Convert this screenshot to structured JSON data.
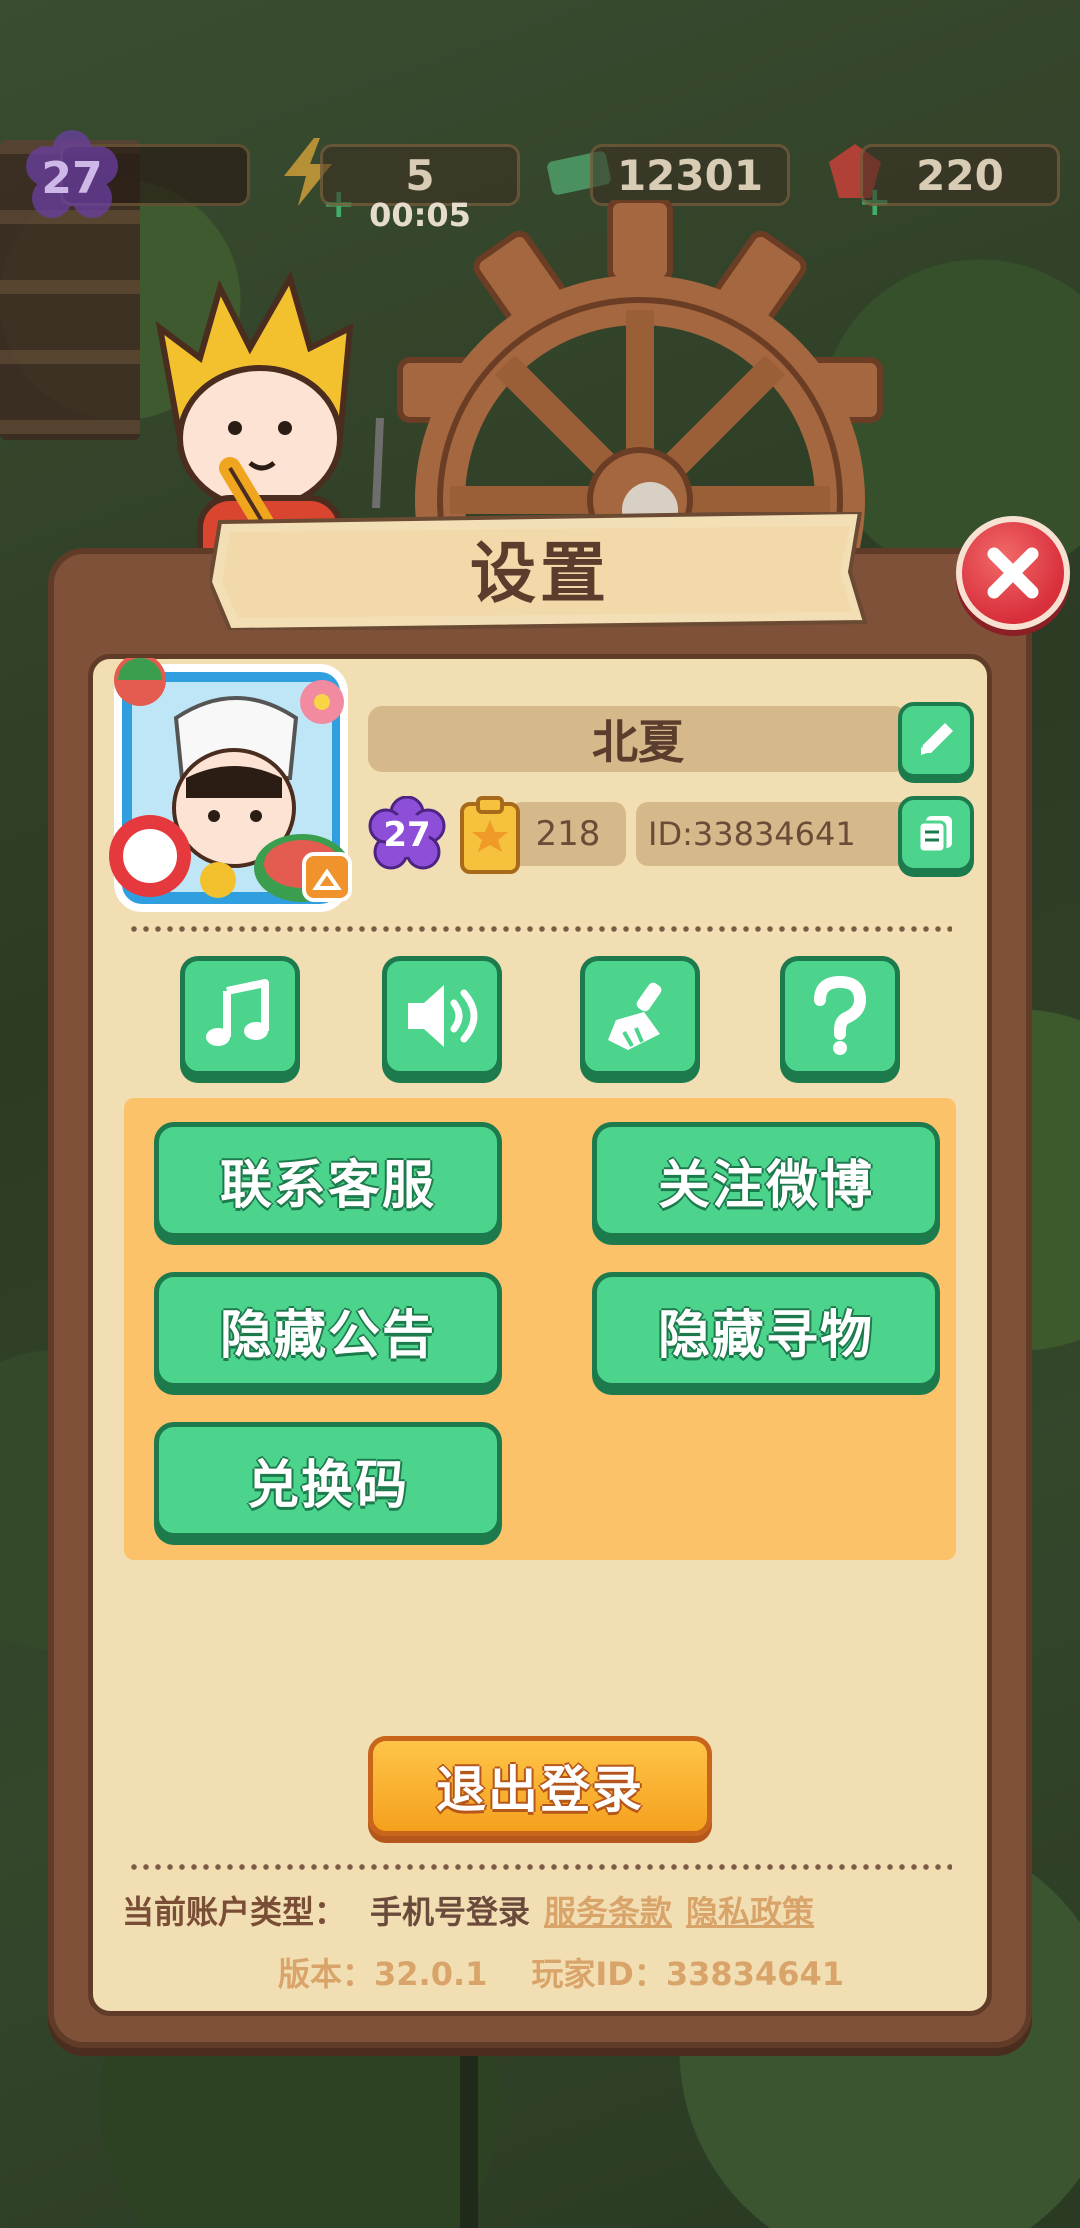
{
  "topbar": {
    "level": "27",
    "energy": "5",
    "energy_timer": "00:05",
    "cash": "12301",
    "gems": "220"
  },
  "dialog": {
    "title": "设置"
  },
  "profile": {
    "name": "北夏",
    "level": "27",
    "stars": "218",
    "id_text": "ID:33834641"
  },
  "settings_icons": [
    "music-icon",
    "sound-icon",
    "broom-icon",
    "help-icon"
  ],
  "menu": {
    "contact_support": "联系客服",
    "follow_weibo": "关注微博",
    "hide_announcement": "隐藏公告",
    "hide_hunt": "隐藏寻物",
    "redeem_code": "兑换码"
  },
  "logout_label": "退出登录",
  "footer": {
    "account_type_label": "当前账户类型：",
    "account_type_value": "手机号登录",
    "terms_link": "服务条款",
    "privacy_link": "隐私政策",
    "version": "版本：32.0.1",
    "player_id": "玩家ID：33834641"
  },
  "colors": {
    "panel_brown": "#7e5138",
    "panel_cream": "#f2deb3",
    "button_green": "#4cd38c",
    "button_green_dark": "#1d7a4c",
    "orange_area": "#fbc26a",
    "logout_orange": "#f5a11e",
    "close_red": "#d82f3b"
  }
}
